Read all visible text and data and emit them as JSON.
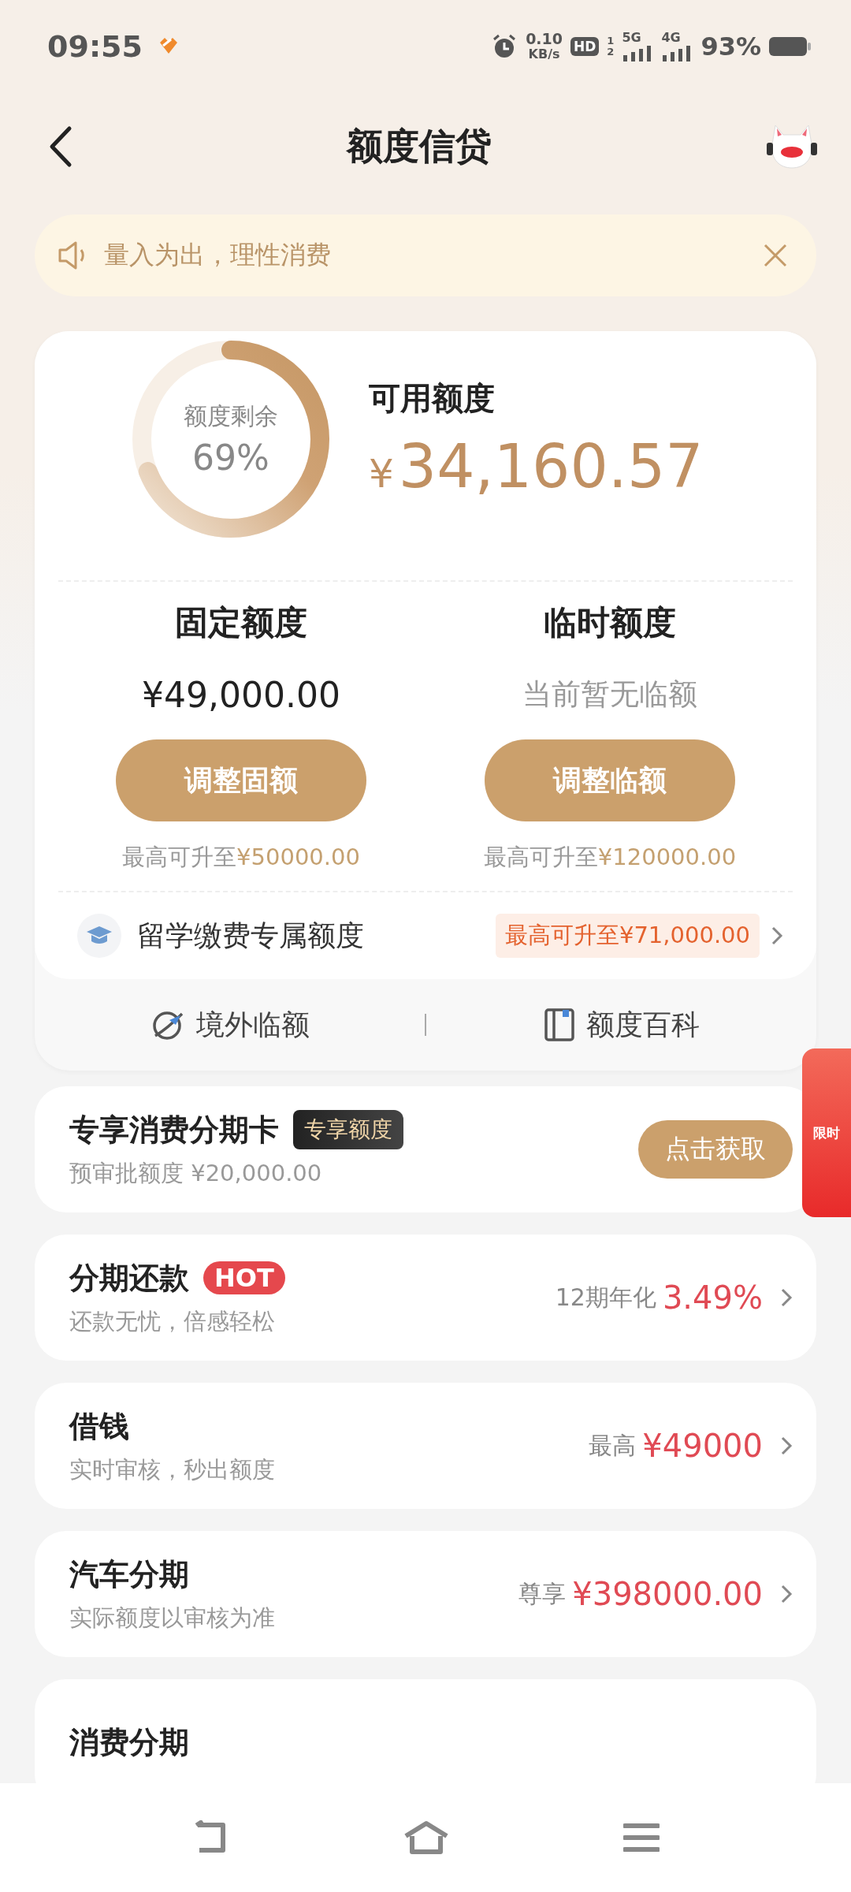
{
  "status_bar": {
    "time": "09:55",
    "net_speed": "0.10",
    "net_speed_unit": "KB/s",
    "hd": "HD",
    "hd_slots": [
      "1",
      "2"
    ],
    "sim_1": "5G",
    "sim_2": "4G",
    "battery": "93%"
  },
  "header": {
    "title": "额度信贷"
  },
  "notice": {
    "text": "量入为出，理性消费"
  },
  "credit": {
    "ring_label": "额度剩余",
    "ring_percent": "69%",
    "level": 0.69,
    "available_label": "可用额度",
    "currency": "¥",
    "available_amount": "34,160.57",
    "columns": [
      {
        "title": "固定额度",
        "kind": "amount",
        "value": "¥49,000.00",
        "button": "调整固额",
        "hint": "最高可升至",
        "hint_amount": "¥50000.00"
      },
      {
        "title": "临时额度",
        "kind": "empty",
        "value": "当前暂无临额",
        "button": "调整临额",
        "hint": "最高可升至",
        "hint_amount": "¥120000.00"
      }
    ],
    "study": {
      "label": "留学缴费专属额度",
      "tag": "最高可升至¥71,000.00"
    },
    "links": [
      "境外临额",
      "额度百科"
    ]
  },
  "promo_tab": {
    "text": "限时"
  },
  "card_offer": {
    "title": "专享消费分期卡",
    "badge": "专享额度",
    "subtitle": "预审批额度 ¥20,000.00",
    "button": "点击获取"
  },
  "products": [
    {
      "title": "分期还款",
      "badge": "HOT",
      "subtitle": "还款无忧，倍感轻松",
      "prefix": "12期年化",
      "value": "3.49%"
    },
    {
      "title": "借钱",
      "subtitle": "实时审核，秒出额度",
      "prefix": "最高",
      "value": "¥49000"
    },
    {
      "title": "汽车分期",
      "subtitle": "实际额度以审核为准",
      "prefix": "尊享",
      "value": "¥398000.00"
    },
    {
      "title": "消费分期"
    }
  ]
}
